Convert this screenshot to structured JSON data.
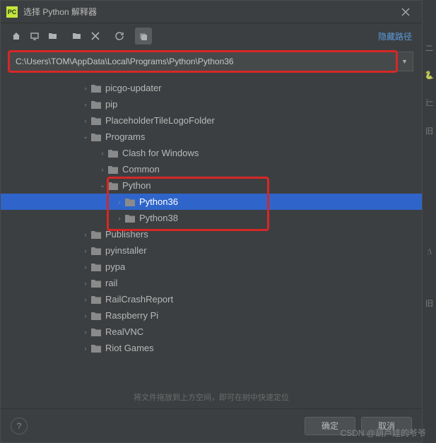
{
  "title": "选择 Python 解释器",
  "toolbar": {
    "home": "⌂",
    "desktop": "◻",
    "new_folder": "📁",
    "module": "📁",
    "delete": "✕",
    "refresh": "↻",
    "copy": "⧉",
    "hide_path": "隐藏路径"
  },
  "path": "C:\\Users\\TOM\\AppData\\Local\\Programs\\Python\\Python36",
  "tree": {
    "items": [
      {
        "depth": 3,
        "exp": "collapsed",
        "label": "picgo-updater"
      },
      {
        "depth": 3,
        "exp": "collapsed",
        "label": "pip"
      },
      {
        "depth": 3,
        "exp": "collapsed",
        "label": "PlaceholderTileLogoFolder"
      },
      {
        "depth": 3,
        "exp": "expanded",
        "label": "Programs"
      },
      {
        "depth": 4,
        "exp": "collapsed",
        "label": "Clash for Windows"
      },
      {
        "depth": 4,
        "exp": "collapsed",
        "label": "Common"
      },
      {
        "depth": 4,
        "exp": "expanded",
        "label": "Python"
      },
      {
        "depth": 5,
        "exp": "collapsed",
        "label": "Python36",
        "selected": true
      },
      {
        "depth": 5,
        "exp": "collapsed",
        "label": "Python38"
      },
      {
        "depth": 3,
        "exp": "collapsed",
        "label": "Publishers"
      },
      {
        "depth": 3,
        "exp": "collapsed",
        "label": "pyinstaller"
      },
      {
        "depth": 3,
        "exp": "collapsed",
        "label": "pypa"
      },
      {
        "depth": 3,
        "exp": "collapsed",
        "label": "rail"
      },
      {
        "depth": 3,
        "exp": "collapsed",
        "label": "RailCrashReport"
      },
      {
        "depth": 3,
        "exp": "collapsed",
        "label": "Raspberry Pi"
      },
      {
        "depth": 3,
        "exp": "collapsed",
        "label": "RealVNC"
      },
      {
        "depth": 3,
        "exp": "collapsed",
        "label": "Riot Games"
      }
    ]
  },
  "hint": "将文件拖放到上方空间，即可在树中快速定位",
  "footer": {
    "ok": "确定",
    "cancel": "取消"
  },
  "watermark": "CSDN @葫芦娃的爷爷",
  "side": {
    "a": "二",
    "b": "辷",
    "c": "旧",
    "d": ":\\",
    "e": "旧"
  }
}
